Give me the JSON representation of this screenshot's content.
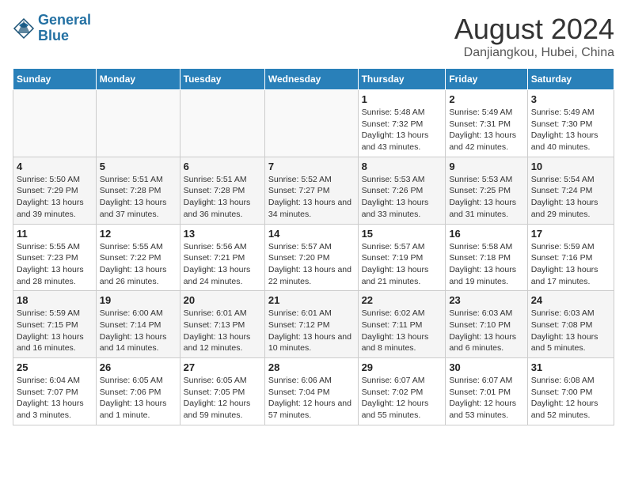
{
  "header": {
    "logo_line1": "General",
    "logo_line2": "Blue",
    "main_title": "August 2024",
    "subtitle": "Danjiangkou, Hubei, China"
  },
  "days_of_week": [
    "Sunday",
    "Monday",
    "Tuesday",
    "Wednesday",
    "Thursday",
    "Friday",
    "Saturday"
  ],
  "weeks": [
    [
      {
        "date": "",
        "info": ""
      },
      {
        "date": "",
        "info": ""
      },
      {
        "date": "",
        "info": ""
      },
      {
        "date": "",
        "info": ""
      },
      {
        "date": "1",
        "sunrise": "Sunrise: 5:48 AM",
        "sunset": "Sunset: 7:32 PM",
        "daylight": "Daylight: 13 hours and 43 minutes."
      },
      {
        "date": "2",
        "sunrise": "Sunrise: 5:49 AM",
        "sunset": "Sunset: 7:31 PM",
        "daylight": "Daylight: 13 hours and 42 minutes."
      },
      {
        "date": "3",
        "sunrise": "Sunrise: 5:49 AM",
        "sunset": "Sunset: 7:30 PM",
        "daylight": "Daylight: 13 hours and 40 minutes."
      }
    ],
    [
      {
        "date": "4",
        "sunrise": "Sunrise: 5:50 AM",
        "sunset": "Sunset: 7:29 PM",
        "daylight": "Daylight: 13 hours and 39 minutes."
      },
      {
        "date": "5",
        "sunrise": "Sunrise: 5:51 AM",
        "sunset": "Sunset: 7:28 PM",
        "daylight": "Daylight: 13 hours and 37 minutes."
      },
      {
        "date": "6",
        "sunrise": "Sunrise: 5:51 AM",
        "sunset": "Sunset: 7:28 PM",
        "daylight": "Daylight: 13 hours and 36 minutes."
      },
      {
        "date": "7",
        "sunrise": "Sunrise: 5:52 AM",
        "sunset": "Sunset: 7:27 PM",
        "daylight": "Daylight: 13 hours and 34 minutes."
      },
      {
        "date": "8",
        "sunrise": "Sunrise: 5:53 AM",
        "sunset": "Sunset: 7:26 PM",
        "daylight": "Daylight: 13 hours and 33 minutes."
      },
      {
        "date": "9",
        "sunrise": "Sunrise: 5:53 AM",
        "sunset": "Sunset: 7:25 PM",
        "daylight": "Daylight: 13 hours and 31 minutes."
      },
      {
        "date": "10",
        "sunrise": "Sunrise: 5:54 AM",
        "sunset": "Sunset: 7:24 PM",
        "daylight": "Daylight: 13 hours and 29 minutes."
      }
    ],
    [
      {
        "date": "11",
        "sunrise": "Sunrise: 5:55 AM",
        "sunset": "Sunset: 7:23 PM",
        "daylight": "Daylight: 13 hours and 28 minutes."
      },
      {
        "date": "12",
        "sunrise": "Sunrise: 5:55 AM",
        "sunset": "Sunset: 7:22 PM",
        "daylight": "Daylight: 13 hours and 26 minutes."
      },
      {
        "date": "13",
        "sunrise": "Sunrise: 5:56 AM",
        "sunset": "Sunset: 7:21 PM",
        "daylight": "Daylight: 13 hours and 24 minutes."
      },
      {
        "date": "14",
        "sunrise": "Sunrise: 5:57 AM",
        "sunset": "Sunset: 7:20 PM",
        "daylight": "Daylight: 13 hours and 22 minutes."
      },
      {
        "date": "15",
        "sunrise": "Sunrise: 5:57 AM",
        "sunset": "Sunset: 7:19 PM",
        "daylight": "Daylight: 13 hours and 21 minutes."
      },
      {
        "date": "16",
        "sunrise": "Sunrise: 5:58 AM",
        "sunset": "Sunset: 7:18 PM",
        "daylight": "Daylight: 13 hours and 19 minutes."
      },
      {
        "date": "17",
        "sunrise": "Sunrise: 5:59 AM",
        "sunset": "Sunset: 7:16 PM",
        "daylight": "Daylight: 13 hours and 17 minutes."
      }
    ],
    [
      {
        "date": "18",
        "sunrise": "Sunrise: 5:59 AM",
        "sunset": "Sunset: 7:15 PM",
        "daylight": "Daylight: 13 hours and 16 minutes."
      },
      {
        "date": "19",
        "sunrise": "Sunrise: 6:00 AM",
        "sunset": "Sunset: 7:14 PM",
        "daylight": "Daylight: 13 hours and 14 minutes."
      },
      {
        "date": "20",
        "sunrise": "Sunrise: 6:01 AM",
        "sunset": "Sunset: 7:13 PM",
        "daylight": "Daylight: 13 hours and 12 minutes."
      },
      {
        "date": "21",
        "sunrise": "Sunrise: 6:01 AM",
        "sunset": "Sunset: 7:12 PM",
        "daylight": "Daylight: 13 hours and 10 minutes."
      },
      {
        "date": "22",
        "sunrise": "Sunrise: 6:02 AM",
        "sunset": "Sunset: 7:11 PM",
        "daylight": "Daylight: 13 hours and 8 minutes."
      },
      {
        "date": "23",
        "sunrise": "Sunrise: 6:03 AM",
        "sunset": "Sunset: 7:10 PM",
        "daylight": "Daylight: 13 hours and 6 minutes."
      },
      {
        "date": "24",
        "sunrise": "Sunrise: 6:03 AM",
        "sunset": "Sunset: 7:08 PM",
        "daylight": "Daylight: 13 hours and 5 minutes."
      }
    ],
    [
      {
        "date": "25",
        "sunrise": "Sunrise: 6:04 AM",
        "sunset": "Sunset: 7:07 PM",
        "daylight": "Daylight: 13 hours and 3 minutes."
      },
      {
        "date": "26",
        "sunrise": "Sunrise: 6:05 AM",
        "sunset": "Sunset: 7:06 PM",
        "daylight": "Daylight: 13 hours and 1 minute."
      },
      {
        "date": "27",
        "sunrise": "Sunrise: 6:05 AM",
        "sunset": "Sunset: 7:05 PM",
        "daylight": "Daylight: 12 hours and 59 minutes."
      },
      {
        "date": "28",
        "sunrise": "Sunrise: 6:06 AM",
        "sunset": "Sunset: 7:04 PM",
        "daylight": "Daylight: 12 hours and 57 minutes."
      },
      {
        "date": "29",
        "sunrise": "Sunrise: 6:07 AM",
        "sunset": "Sunset: 7:02 PM",
        "daylight": "Daylight: 12 hours and 55 minutes."
      },
      {
        "date": "30",
        "sunrise": "Sunrise: 6:07 AM",
        "sunset": "Sunset: 7:01 PM",
        "daylight": "Daylight: 12 hours and 53 minutes."
      },
      {
        "date": "31",
        "sunrise": "Sunrise: 6:08 AM",
        "sunset": "Sunset: 7:00 PM",
        "daylight": "Daylight: 12 hours and 52 minutes."
      }
    ]
  ]
}
